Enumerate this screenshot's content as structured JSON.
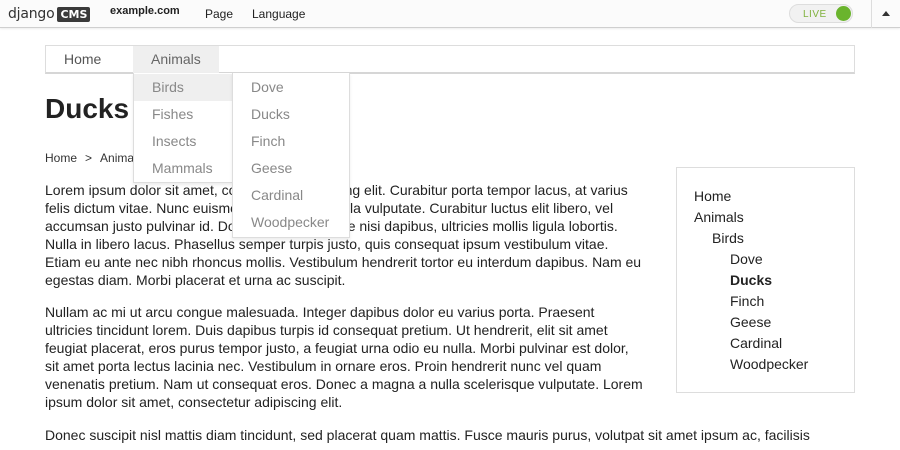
{
  "toolbar": {
    "logo_text": "django",
    "logo_box": "CMS",
    "site": "example.com",
    "menu": [
      "Page",
      "Language"
    ],
    "live_label": "LIVE",
    "live_color": "#6ab42d"
  },
  "nav": {
    "items": [
      "Home",
      "Animals"
    ],
    "active": "Animals"
  },
  "dropdown_level1": [
    "Birds",
    "Fishes",
    "Insects",
    "Mammals"
  ],
  "dropdown_level2": [
    "Dove",
    "Ducks",
    "Finch",
    "Geese",
    "Cardinal",
    "Woodpecker"
  ],
  "page": {
    "title": "Ducks",
    "breadcrumb": [
      "Home",
      "Animals"
    ],
    "breadcrumb_sep": ">",
    "paragraphs": [
      [
        "Lorem ipsum dolor sit amet, consectetur adipiscing elit. Curabitur porta tempor lacus, at varius",
        "felis dictum vitae. Nunc euismod ut nisi eu vehicula vulputate. Curabitur luctus elit libero, vel",
        "accumsan justo pulvinar id. Donec venenatis vitae nisi dapibus, ultricies mollis ligula lobortis.",
        "Nulla in libero lacus. Phasellus semper turpis justo, quis consequat ipsum vestibulum vitae.",
        "Etiam eu ante nec nibh rhoncus mollis. Vestibulum hendrerit tortor eu interdum dapibus. Nam eu",
        "egestas diam. Morbi placerat et urna ac suscipit."
      ],
      [
        "Nullam ac mi ut arcu congue malesuada. Integer dapibus dolor eu varius porta. Praesent",
        "ultricies tincidunt lorem. Duis dapibus turpis id consequat pretium. Ut hendrerit, elit sit amet",
        "feugiat placerat, eros purus tempor justo, a feugiat urna odio eu nulla. Morbi pulvinar est dolor,",
        "sit amet porta lectus lacinia nec. Vestibulum in ornare eros. Proin hendrerit nunc vel quam",
        "venenatis pretium. Nam ut consequat eros. Donec a magna a nulla scelerisque vulputate. Lorem",
        "ipsum dolor sit amet, consectetur adipiscing elit."
      ],
      [
        "Donec suscipit nisl mattis diam tincidunt, sed placerat quam mattis. Fusce mauris purus, volutpat sit amet ipsum ac, facilisis"
      ]
    ]
  },
  "sidebar": {
    "items": [
      {
        "label": "Home",
        "level": 0,
        "current": false
      },
      {
        "label": "Animals",
        "level": 0,
        "current": false
      },
      {
        "label": "Birds",
        "level": 1,
        "current": false
      },
      {
        "label": "Dove",
        "level": 2,
        "current": false
      },
      {
        "label": "Ducks",
        "level": 2,
        "current": true
      },
      {
        "label": "Finch",
        "level": 2,
        "current": false
      },
      {
        "label": "Geese",
        "level": 2,
        "current": false
      },
      {
        "label": "Cardinal",
        "level": 2,
        "current": false
      },
      {
        "label": "Woodpecker",
        "level": 2,
        "current": false
      }
    ]
  }
}
